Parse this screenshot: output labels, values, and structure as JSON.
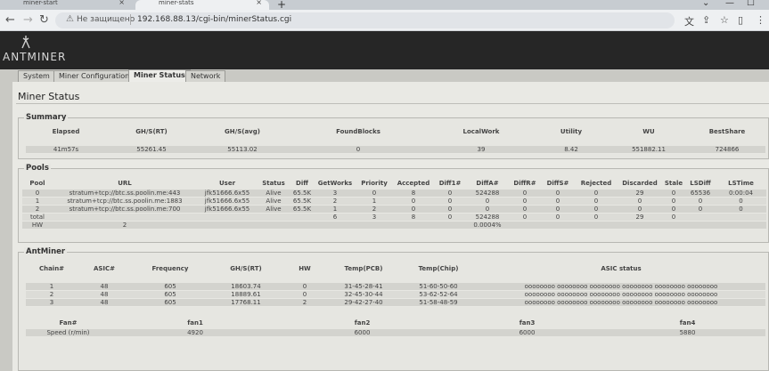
{
  "browser": {
    "tabs": [
      {
        "label": "miner-start"
      },
      {
        "label": "miner-stats"
      }
    ],
    "new_tab": "+",
    "security": "Не защищено",
    "url": "192.168.88.13/cgi-bin/minerStatus.cgi"
  },
  "header": {
    "logo": "ANTMINER"
  },
  "menu": {
    "tabs": [
      {
        "label": "System"
      },
      {
        "label": "Miner Configuration"
      },
      {
        "label": "Miner Status",
        "active": true
      },
      {
        "label": "Network"
      }
    ]
  },
  "page": {
    "title": "Miner Status"
  },
  "summary": {
    "legend": "Summary",
    "headers": [
      "Elapsed",
      "GH/S(RT)",
      "GH/S(avg)",
      "FoundBlocks",
      "LocalWork",
      "Utility",
      "WU",
      "BestShare"
    ],
    "values": [
      "41m57s",
      "55261.45",
      "55113.02",
      "0",
      "39",
      "8.42",
      "551882.11",
      "724866"
    ]
  },
  "pools": {
    "legend": "Pools",
    "headers": [
      "Pool",
      "URL",
      "User",
      "Status",
      "Diff",
      "GetWorks",
      "Priority",
      "Accepted",
      "Diff1#",
      "DiffA#",
      "DiffR#",
      "DiffS#",
      "Rejected",
      "Discarded",
      "Stale",
      "LSDiff",
      "LSTime"
    ],
    "rows": [
      [
        "0",
        "stratum+tcp://btc.ss.poolin.me:443",
        "jfk51666.6x55",
        "Alive",
        "65.5K",
        "3",
        "0",
        "8",
        "0",
        "524288",
        "0",
        "0",
        "0",
        "29",
        "0",
        "65536",
        "0:00:04"
      ],
      [
        "1",
        "stratum+tcp://btc.ss.poolin.me:1883",
        "jfk51666.6x55",
        "Alive",
        "65.5K",
        "2",
        "1",
        "0",
        "0",
        "0",
        "0",
        "0",
        "0",
        "0",
        "0",
        "0",
        "0"
      ],
      [
        "2",
        "stratum+tcp://btc.ss.poolin.me:700",
        "jfk51666.6x55",
        "Alive",
        "65.5K",
        "1",
        "2",
        "0",
        "0",
        "0",
        "0",
        "0",
        "0",
        "0",
        "0",
        "0",
        "0"
      ],
      [
        "total",
        "",
        "",
        "",
        "",
        "6",
        "3",
        "8",
        "0",
        "524288",
        "0",
        "0",
        "0",
        "29",
        "0",
        "",
        ""
      ],
      [
        "HW",
        "2",
        "",
        "",
        "",
        "",
        "",
        "",
        "",
        "0.0004%",
        "",
        "",
        "",
        "",
        "",
        "",
        ""
      ]
    ]
  },
  "antminer": {
    "legend": "AntMiner",
    "chain_headers": [
      "Chain#",
      "ASIC#",
      "Frequency",
      "GH/S(RT)",
      "HW",
      "Temp(PCB)",
      "Temp(Chip)",
      "ASIC status"
    ],
    "chains": [
      [
        "1",
        "48",
        "605",
        "18603.74",
        "0",
        "31-45-28-41",
        "51-60-50-60",
        "oooooooo oooooooo oooooooo oooooooo oooooooo oooooooo"
      ],
      [
        "2",
        "48",
        "605",
        "18889.61",
        "0",
        "32-45-30-44",
        "53-62-52-64",
        "oooooooo oooooooo oooooooo oooooooo oooooooo oooooooo"
      ],
      [
        "3",
        "48",
        "605",
        "17768.11",
        "2",
        "29-42-27-40",
        "51-58-48-59",
        "oooooooo oooooooo oooooooo oooooooo oooooooo oooooooo"
      ]
    ],
    "fan_headers": [
      "Fan#",
      "fan1",
      "fan2",
      "fan3",
      "fan4"
    ],
    "fan_values": [
      "Speed (r/min)",
      "4920",
      "6000",
      "6000",
      "5880"
    ]
  }
}
